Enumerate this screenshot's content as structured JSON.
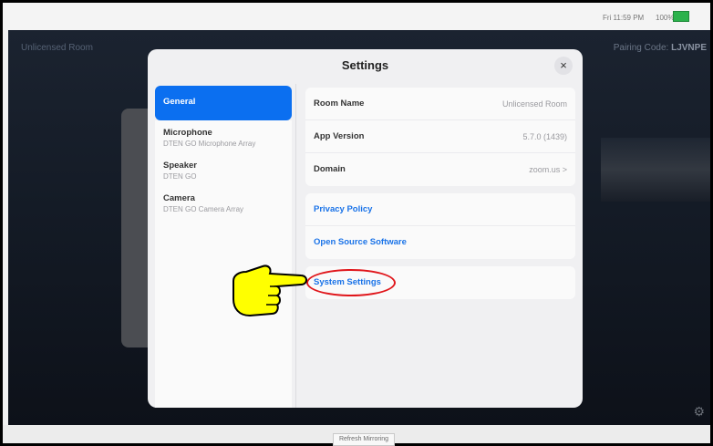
{
  "status_bar": {
    "time": "Fri 11:59 PM",
    "battery": "100%",
    "battery_icon": "battery-icon"
  },
  "background": {
    "room_name": "Unlicensed Room",
    "pairing_label": "Pairing Code:",
    "pairing_code": "LJVNPE"
  },
  "modal": {
    "title": "Settings",
    "close_label": "×",
    "sidebar": [
      {
        "title": "General",
        "sub": ""
      },
      {
        "title": "Microphone",
        "sub": "DTEN GO Microphone Array"
      },
      {
        "title": "Speaker",
        "sub": "DTEN GO"
      },
      {
        "title": "Camera",
        "sub": "DTEN GO Camera Array"
      }
    ],
    "info": [
      {
        "label": "Room Name",
        "value": "Unlicensed Room"
      },
      {
        "label": "App Version",
        "value": "5.7.0 (1439)"
      },
      {
        "label": "Domain",
        "value": "zoom.us  >"
      }
    ],
    "links": [
      "Privacy Policy",
      "Open Source Software"
    ],
    "system_settings": "System Settings"
  },
  "bottom": {
    "refresh_label": "Refresh Mirroring"
  },
  "accent_color": "#0b6ff0",
  "link_color": "#1a73e8",
  "highlight_color": "#e0161b"
}
